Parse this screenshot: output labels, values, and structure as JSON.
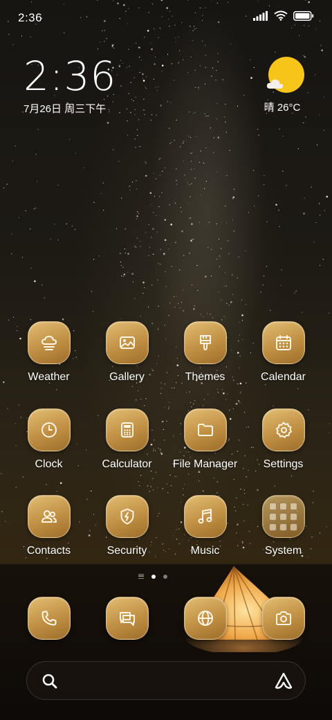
{
  "status_bar": {
    "time": "2:36",
    "icons": [
      "signal-icon",
      "wifi-icon",
      "battery-icon"
    ]
  },
  "clock_widget": {
    "time": "2:36",
    "date": "7月26日 周三下午"
  },
  "weather_widget": {
    "icon": "sun-cloud-icon",
    "text": "晴 26°C"
  },
  "apps": [
    {
      "label": "Weather",
      "icon": "weather-icon"
    },
    {
      "label": "Gallery",
      "icon": "gallery-icon"
    },
    {
      "label": "Themes",
      "icon": "themes-icon"
    },
    {
      "label": "Calendar",
      "icon": "calendar-icon"
    },
    {
      "label": "Clock",
      "icon": "clock-icon"
    },
    {
      "label": "Calculator",
      "icon": "calculator-icon"
    },
    {
      "label": "File Manager",
      "icon": "folder-icon"
    },
    {
      "label": "Settings",
      "icon": "gear-icon"
    },
    {
      "label": "Contacts",
      "icon": "contacts-icon"
    },
    {
      "label": "Security",
      "icon": "shield-icon"
    },
    {
      "label": "Music",
      "icon": "music-note-icon"
    },
    {
      "label": "System",
      "icon": "app-folder-icon"
    }
  ],
  "page_indicator": {
    "pages": 2,
    "current": 1
  },
  "dock": [
    {
      "icon": "phone-icon"
    },
    {
      "icon": "messages-icon"
    },
    {
      "icon": "browser-globe-icon"
    },
    {
      "icon": "camera-icon"
    }
  ],
  "search_bar": {
    "icons": [
      "search-icon",
      "assistant-icon"
    ]
  },
  "colors": {
    "icon_gold": "#c9974a",
    "sun_yellow": "#f7c51a",
    "icon_glyph": "#fff6e6"
  }
}
